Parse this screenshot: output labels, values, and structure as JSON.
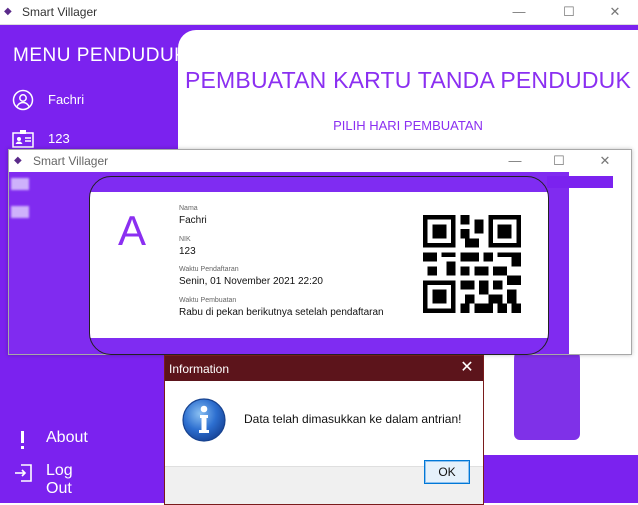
{
  "main_window": {
    "title": "Smart Villager",
    "controls": {
      "minimize": "—",
      "maximize": "☐",
      "close": "✕"
    }
  },
  "sidebar": {
    "title": "MENU PENDUDUK",
    "user_name": "Fachri",
    "user_nik": "123",
    "about_label": "About",
    "logout_label": "Log Out"
  },
  "content": {
    "title": "PEMBUATAN KARTU TANDA PENDUDUK",
    "subtitle": "PILIH HARI PEMBUATAN"
  },
  "result_window": {
    "title": "Smart Villager",
    "controls": {
      "minimize": "—",
      "maximize": "☐",
      "close": "✕"
    },
    "card": {
      "initial": "A",
      "nama_label": "Nama",
      "nama_value": "Fachri",
      "nik_label": "NIK",
      "nik_value": "123",
      "daftar_label": "Waktu Pendaftaran",
      "daftar_value": "Senin, 01 November 2021 22:20",
      "pembuatan_label": "Waktu Pembuatan",
      "pembuatan_value": "Rabu di pekan berikutnya setelah pendaftaran"
    }
  },
  "dialog": {
    "title": "Information",
    "close": "✕",
    "message": "Data telah dimasukkan ke dalam antrian!",
    "ok_label": "OK"
  },
  "colors": {
    "purple": "#7b22ef",
    "title_purple": "#8b2ff1",
    "dialog_title": "#5c141b"
  }
}
